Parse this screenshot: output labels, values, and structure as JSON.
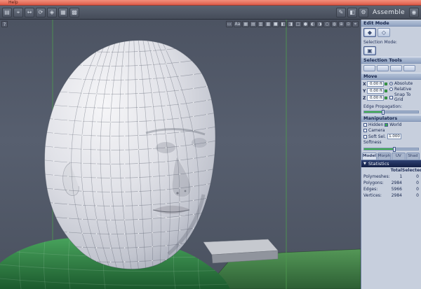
{
  "colors": {
    "titlebar": "#dd5c4a",
    "accent_green": "#3fae4f",
    "panel_bg": "#c7cfdd",
    "viewport_bg": "#545c6b"
  },
  "titlebar": {
    "help_label": "Help"
  },
  "menubar": {
    "left_icons": [
      {
        "name": "scene-icon",
        "glyph": "▤"
      },
      {
        "name": "select-tool-icon",
        "glyph": "⌖"
      },
      {
        "name": "move-tool-icon",
        "glyph": "↔"
      },
      {
        "name": "rotate-tool-icon",
        "glyph": "⟳"
      },
      {
        "name": "scale-tool-icon",
        "glyph": "◈"
      },
      {
        "name": "grid-icon",
        "glyph": "▦"
      },
      {
        "name": "snap-icon",
        "glyph": "▩"
      }
    ],
    "right_icons": [
      {
        "name": "edit-room-icon",
        "glyph": "✎"
      },
      {
        "name": "shading-room-icon",
        "glyph": "◧"
      },
      {
        "name": "settings-gear-icon",
        "glyph": "⚙"
      }
    ],
    "mode_label": "Assemble",
    "trailing_icons": [
      {
        "name": "info-icon",
        "glyph": "◉"
      }
    ]
  },
  "viewport": {
    "help_icon": "?",
    "toolbar_icons": [
      {
        "name": "selection-filter-icon",
        "glyph": "▭"
      },
      {
        "name": "text-display-icon",
        "glyph": "Aa"
      },
      {
        "name": "grid-display-icon",
        "glyph": "▦"
      },
      {
        "name": "wireframe-mode-icon",
        "glyph": "▤"
      },
      {
        "name": "hidden-line-mode-icon",
        "glyph": "▥"
      },
      {
        "name": "flat-shade-mode-icon",
        "glyph": "▩"
      },
      {
        "name": "smooth-shade-mode-icon",
        "glyph": "■"
      },
      {
        "name": "split-view-icon",
        "glyph": "◧"
      },
      {
        "name": "dual-view-icon",
        "glyph": "◨"
      },
      {
        "name": "single-view-icon",
        "glyph": "□"
      },
      {
        "name": "shaded-sphere-icon",
        "glyph": "●"
      },
      {
        "name": "half-shaded-sphere-icon",
        "glyph": "◐"
      },
      {
        "name": "back-shaded-sphere-icon",
        "glyph": "◑"
      },
      {
        "name": "wire-sphere-icon",
        "glyph": "○"
      },
      {
        "name": "textured-sphere-icon",
        "glyph": "◍"
      },
      {
        "name": "add-view-icon",
        "glyph": "⊕"
      },
      {
        "name": "focus-view-icon",
        "glyph": "⊙"
      },
      {
        "name": "camera-target-icon",
        "glyph": "⌖"
      }
    ]
  },
  "panel": {
    "edit_mode_title": "Edit Mode",
    "edit_mode_buttons": [
      {
        "name": "object-edit-mode-button",
        "glyph": "◆",
        "active": true
      },
      {
        "name": "group-edit-mode-button",
        "glyph": "◇"
      }
    ],
    "selection_mode_label": "Selection Mode:",
    "selection_mode_buttons": [
      {
        "name": "face-selection-mode-button",
        "glyph": "▣",
        "active": true
      }
    ],
    "selection_tools_title": "Selection Tools",
    "selection_tool_buttons": [
      {
        "name": "selection-tool-button-1",
        "glyph": ""
      },
      {
        "name": "selection-tool-button-2",
        "glyph": ""
      },
      {
        "name": "selection-tool-button-3",
        "glyph": ""
      },
      {
        "name": "selection-tool-button-4",
        "glyph": ""
      }
    ],
    "move": {
      "title": "Move",
      "axes": [
        {
          "label": "X",
          "value": "0.00 ft"
        },
        {
          "label": "Y",
          "value": "0.00 ft"
        },
        {
          "label": "Z",
          "value": "0.00 ft"
        }
      ],
      "absolute_label": "Absolute",
      "relative_label": "Relative",
      "snap_label": "Snap To Grid"
    },
    "edge_propagation_label": "Edge Propagation:",
    "manipulators": {
      "title": "Manipulators",
      "hidden_label": "Hidden",
      "world_label": "World",
      "camera_label": "Camera",
      "soft_sel_label": "Soft Sel.",
      "soft_sel_value": "1.000",
      "softness_label": "Softness"
    },
    "tabs": [
      {
        "name": "tab-model",
        "label": "Model",
        "active": true
      },
      {
        "name": "tab-morph",
        "label": "Morph"
      },
      {
        "name": "tab-uv",
        "label": "UV"
      },
      {
        "name": "tab-shad",
        "label": "Shad"
      }
    ],
    "statistics": {
      "title": "Statistics",
      "collapse_icon": "▼",
      "columns": [
        "Total",
        "Selected"
      ],
      "rows": [
        [
          "Polymeshes:",
          "1",
          "0"
        ],
        [
          "Polygons:",
          "2984",
          "0"
        ],
        [
          "Edges:",
          "5966",
          "0"
        ],
        [
          "Vertices:",
          "2984",
          "0"
        ]
      ]
    }
  }
}
